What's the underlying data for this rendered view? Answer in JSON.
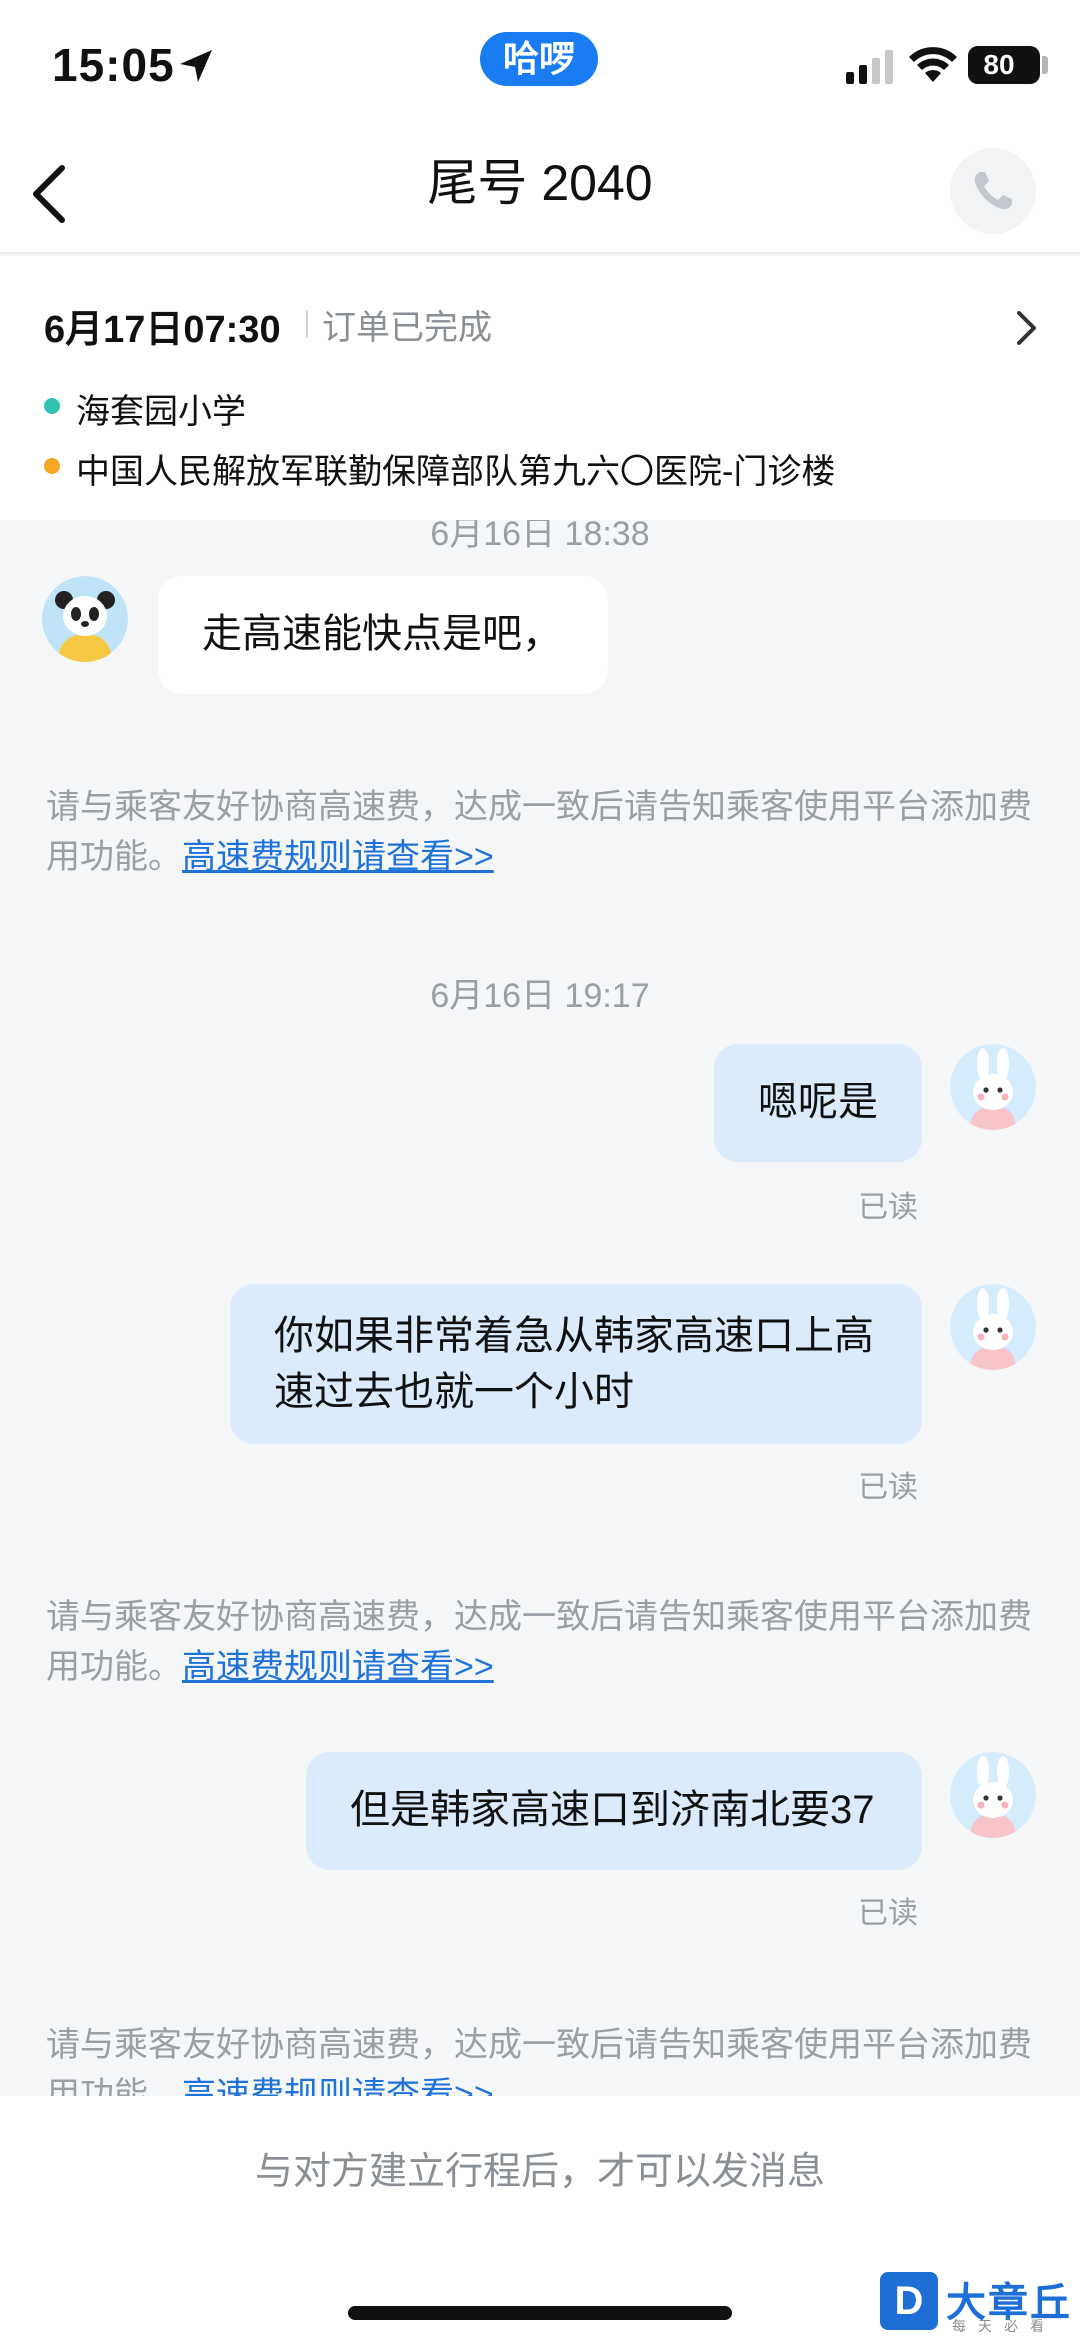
{
  "status_bar": {
    "time": "15:05",
    "app_pill": "哈啰",
    "battery": "80",
    "battery_level_percent": 80
  },
  "nav": {
    "title": "尾号 2040",
    "icons": {
      "back": "chevron-left-icon",
      "phone": "phone-icon"
    }
  },
  "order": {
    "date": "6月17日07:30",
    "status": "订单已完成",
    "origin": "海套园小学",
    "destination": "中国人民解放军联勤保障部队第九六〇医院-门诊楼",
    "colors": {
      "origin_dot": "#2ec4b0",
      "destination_dot": "#f5a623"
    }
  },
  "chat": {
    "timestamp_1": "6月16日 18:38",
    "msg_1": "走高速能快点是吧，",
    "notice_1_text": "请与乘客友好协商高速费，达成一致后请告知乘客使用平台添加费用功能。",
    "notice_1_link": "高速费规则请查看>>",
    "timestamp_2": "6月16日 19:17",
    "msg_2": "嗯呢是",
    "read_2": "已读",
    "msg_3": "你如果非常着急从韩家高速口上高速过去也就一个小时",
    "read_3": "已读",
    "notice_2_text": "请与乘客友好协商高速费，达成一致后请告知乘客使用平台添加费用功能。",
    "notice_2_link": "高速费规则请查看>>",
    "msg_4": "但是韩家高速口到济南北要37",
    "read_4": "已读",
    "notice_3_text": "请与乘客友好协商高速费，达成一致后请告知乘客使用平台添加费用功能。",
    "notice_3_link": "高速费规则请查看>>"
  },
  "bottom": {
    "hint": "与对方建立行程后，才可以发消息"
  },
  "watermark": {
    "logo": "D",
    "text": "大章丘",
    "sub": "每天必看"
  },
  "colors": {
    "brand_blue": "#1a7cf2",
    "link_blue": "#1f73d8",
    "outgoing_bubble": "#dcebfb"
  }
}
